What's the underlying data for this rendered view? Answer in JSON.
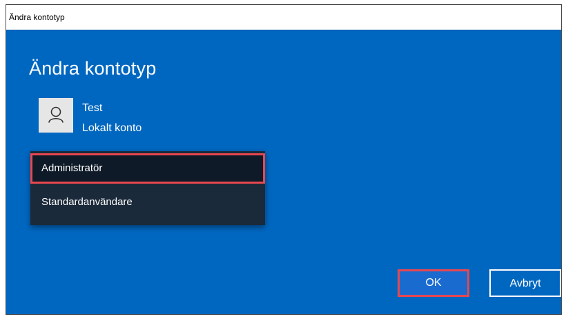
{
  "window": {
    "title": "Ändra kontotyp"
  },
  "dialog": {
    "heading": "Ändra kontotyp"
  },
  "account": {
    "name": "Test",
    "type": "Lokalt konto",
    "avatar_icon": "person-icon"
  },
  "account_type_dropdown": {
    "options": [
      "Administratör",
      "Standardanvändare"
    ],
    "selected": "Administratör"
  },
  "buttons": {
    "ok_label": "OK",
    "cancel_label": "Avbryt"
  },
  "colors": {
    "dialog_background": "#0067c0",
    "dropdown_background": "#1b2a3a",
    "highlight_outline": "#e8474f",
    "text": "#ffffff"
  }
}
